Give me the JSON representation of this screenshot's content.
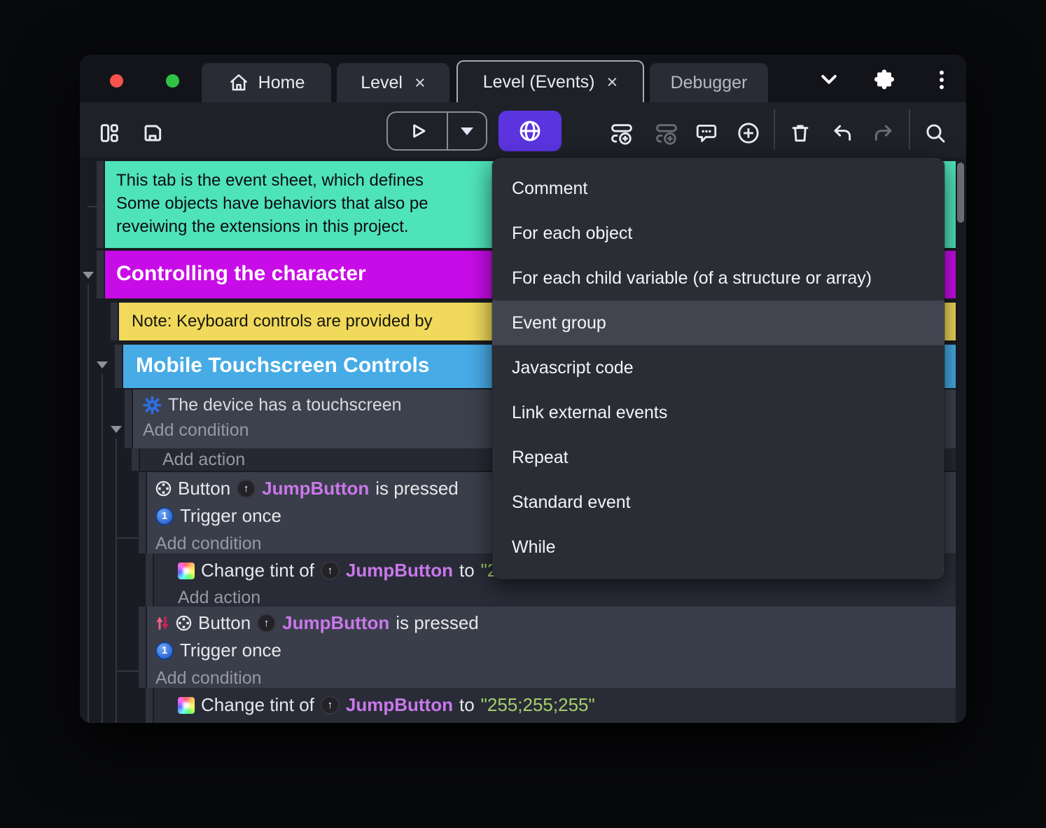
{
  "tabs": {
    "home": "Home",
    "level": "Level",
    "level_events": "Level (Events)",
    "debugger_tab": "Debugger",
    "close_glyph": "×"
  },
  "toolbar": {
    "icons": [
      "panel-layout",
      "save",
      "play",
      "run-options-caret",
      "preview-globe",
      "add-event",
      "add-subevent",
      "add-comment",
      "add-circle",
      "delete",
      "undo",
      "redo",
      "search"
    ]
  },
  "tabbar_icons": [
    "chevron-down",
    "extensions-puzzle",
    "overflow-dots"
  ],
  "menu": {
    "items": [
      "Comment",
      "For each object",
      "For each child variable (of a structure or array)",
      "Event group",
      "Javascript code",
      "Link external events",
      "Repeat",
      "Standard event",
      "While"
    ],
    "selected": "Event group"
  },
  "sheet": {
    "intro_comment": [
      "This tab is the event sheet, which defines",
      "Some objects have behaviors that also pe",
      "reveiwing the extensions in this project."
    ],
    "group_controlling": "Controlling the character",
    "keyboard_note": "Note: Keyboard controls are provided by",
    "group_mobile": "Mobile Touchscreen Controls",
    "touchscreen_condition": "The device has a touchscreen",
    "add_condition": "Add condition",
    "add_action": "Add action",
    "button_pressed": {
      "prefix": "Button",
      "object": "JumpButton",
      "suffix": "is pressed"
    },
    "trigger_once": "Trigger once",
    "trigger_badge": "1",
    "tint": {
      "prefix": "Change tint of",
      "object": "JumpButton",
      "to": "to",
      "value": "\"255;255;255\""
    },
    "up_arrow_glyph": "↑"
  },
  "colors": {
    "preview_button": "#5b34e0",
    "comment_block": "#4fe3ba",
    "group_magenta": "#c80ce8",
    "note_yellow": "#f0d95b",
    "group_blue": "#47abe6",
    "object_name": "#c978ea",
    "string_value": "#a6d06b"
  }
}
